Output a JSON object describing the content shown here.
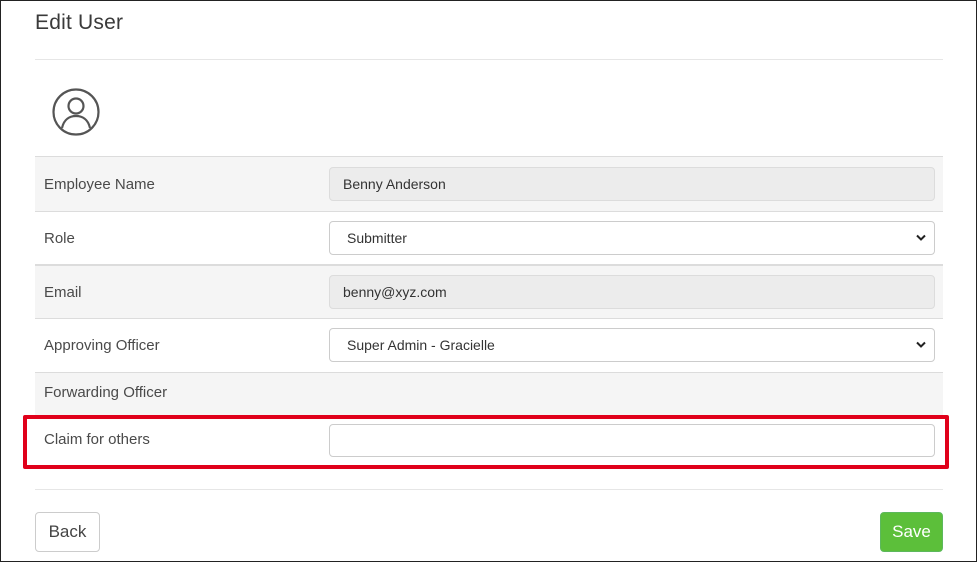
{
  "page": {
    "title": "Edit User"
  },
  "form": {
    "employee_name": {
      "label": "Employee Name",
      "value": "Benny Anderson"
    },
    "role": {
      "label": "Role",
      "value": "Submitter"
    },
    "email": {
      "label": "Email",
      "value": "benny@xyz.com"
    },
    "approving_officer": {
      "label": "Approving Officer",
      "value": "Super Admin - Gracielle"
    },
    "forwarding_officer": {
      "label": "Forwarding Officer"
    },
    "claim_for_others": {
      "label": "Claim for others",
      "value": ""
    }
  },
  "buttons": {
    "back": "Back",
    "save": "Save"
  },
  "icons": {
    "avatar": "user-circle-icon",
    "dropdown": "chevron-down-icon"
  },
  "colors": {
    "highlight": "#e0001a",
    "save": "#5cbf3a"
  }
}
